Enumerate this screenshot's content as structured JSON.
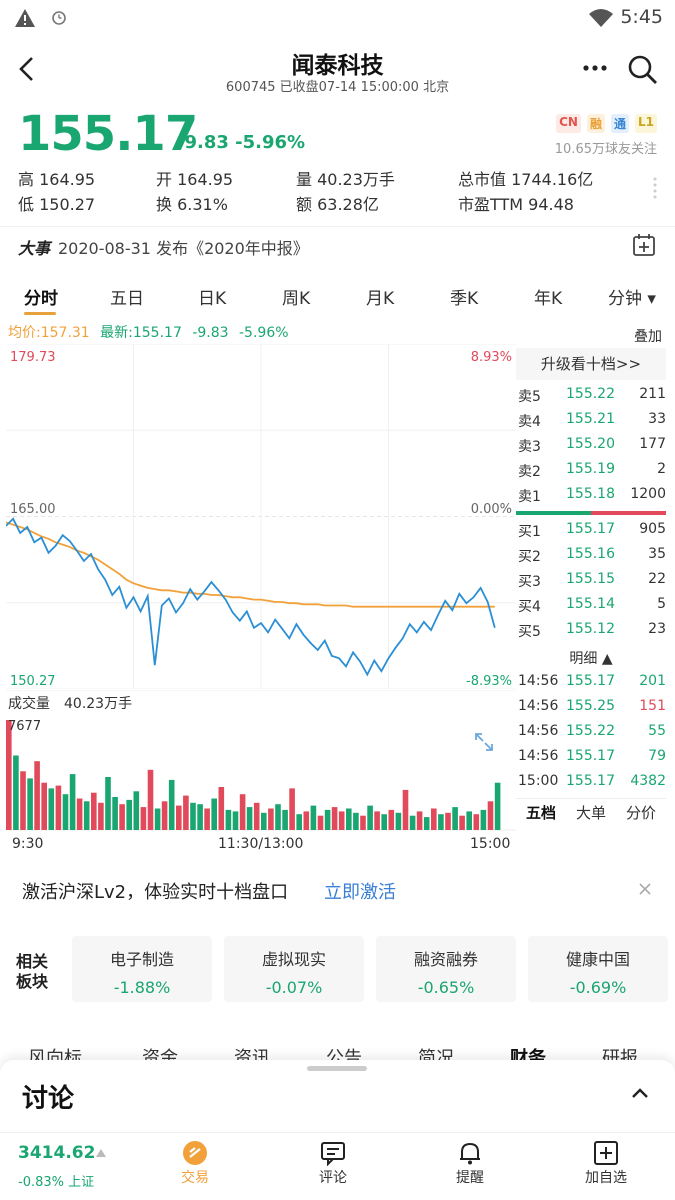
{
  "status_bar": {
    "time": "5:45"
  },
  "header": {
    "title": "闻泰科技",
    "subtitle": "600745 已收盘07-14 15:00:00 北京"
  },
  "quote": {
    "price": "155.17",
    "change": "-9.83",
    "change_pct": "-5.96%",
    "badges": [
      "CN",
      "融",
      "通",
      "L1"
    ],
    "followers": "10.65万球友关注",
    "high_label": "高",
    "high": "164.95",
    "open_label": "开",
    "open": "164.95",
    "volume_label": "量",
    "volume": "40.23万手",
    "mcap_label": "总市值",
    "mcap": "1744.16亿",
    "low_label": "低",
    "low": "150.27",
    "turnover_label": "换",
    "turnover": "6.31%",
    "amount_label": "额",
    "amount": "63.28亿",
    "pe_label": "市盈TTM",
    "pe": "94.48"
  },
  "event": {
    "label": "大事",
    "text": "2020-08-31 发布《2020年中报》"
  },
  "tabs": [
    "分时",
    "五日",
    "日K",
    "周K",
    "月K",
    "季K",
    "年K",
    "分钟 ▾"
  ],
  "chart_info": {
    "avg_label": "均价:157.31",
    "latest_label": "最新:155.17",
    "change": "-9.83",
    "change_pct": "-5.96%",
    "overlay": "叠加"
  },
  "chart_data": {
    "type": "line",
    "title": "",
    "y_top_label": "179.73",
    "y_mid_label": "165.00",
    "y_bottom_label": "150.27",
    "pct_top": "8.93%",
    "pct_mid": "0.00%",
    "pct_bottom": "-8.93%",
    "ylim": [
      150.27,
      179.73
    ],
    "x_ticks": [
      "9:30",
      "11:30/13:00",
      "15:00"
    ],
    "series": [
      {
        "name": "最新",
        "values": [
          164.2,
          164.8,
          163.6,
          164.1,
          162.8,
          163.2,
          161.9,
          162.5,
          163.4,
          162.9,
          162.1,
          161.2,
          161.8,
          160.5,
          159.6,
          158.3,
          159.0,
          157.2,
          158.1,
          156.9,
          158.2,
          152.3,
          157.4,
          158.0,
          156.8,
          157.6,
          158.8,
          157.9,
          158.6,
          159.4,
          158.7,
          157.9,
          156.8,
          156.1,
          156.9,
          155.5,
          155.9,
          155.1,
          156.2,
          155.4,
          154.6,
          155.8,
          154.9,
          154.2,
          153.6,
          154.4,
          153.1,
          152.9,
          152.2,
          153.4,
          152.6,
          151.5,
          152.7,
          151.8,
          152.9,
          153.8,
          154.6,
          155.8,
          155.1,
          156.0,
          155.3,
          156.6,
          157.8,
          157.0,
          158.4,
          157.6,
          158.1,
          158.9,
          157.7,
          155.5
        ]
      },
      {
        "name": "均价",
        "values": [
          164.5,
          164.3,
          164.1,
          163.9,
          163.6,
          163.3,
          163.1,
          162.8,
          162.6,
          162.4,
          162.1,
          161.9,
          161.6,
          161.3,
          160.9,
          160.5,
          160.1,
          159.6,
          159.3,
          159.1,
          158.9,
          158.8,
          158.7,
          158.7,
          158.6,
          158.5,
          158.5,
          158.4,
          158.4,
          158.3,
          158.3,
          158.2,
          158.1,
          158.1,
          158.0,
          157.9,
          157.9,
          157.8,
          157.7,
          157.7,
          157.6,
          157.6,
          157.5,
          157.5,
          157.5,
          157.4,
          157.4,
          157.4,
          157.4,
          157.3,
          157.3,
          157.3,
          157.3,
          157.3,
          157.3,
          157.3,
          157.3,
          157.3,
          157.3,
          157.3,
          157.3,
          157.3,
          157.3,
          157.3,
          157.3,
          157.3,
          157.3,
          157.3,
          157.3,
          157.3
        ]
      }
    ],
    "volume_label": "成交量",
    "volume_total": "40.23万手",
    "volume_max": "7677",
    "volume": [
      7677,
      5200,
      4100,
      3600,
      4800,
      3300,
      2900,
      3100,
      2500,
      3900,
      2200,
      2000,
      2600,
      1900,
      3700,
      2300,
      1800,
      2100,
      2700,
      1600,
      4200,
      1500,
      2000,
      3500,
      1700,
      2400,
      1900,
      1800,
      1500,
      2200,
      3000,
      1400,
      1300,
      2500,
      1600,
      1900,
      1200,
      1500,
      1800,
      1400,
      2900,
      1100,
      1300,
      1700,
      1000,
      1400,
      1600,
      1300,
      1500,
      1200,
      1000,
      1700,
      1300,
      1100,
      1400,
      1200,
      2800,
      1000,
      1300,
      900,
      1500,
      1100,
      1200,
      1600,
      1000,
      1300,
      1100,
      1400,
      2000,
      3300
    ],
    "volume_up": [
      true,
      false,
      true,
      false,
      true,
      true,
      false,
      true,
      false,
      false,
      true,
      false,
      true,
      true,
      false,
      false,
      true,
      false,
      false,
      true,
      true,
      false,
      true,
      false,
      true,
      true,
      false,
      false,
      true,
      false,
      true,
      false,
      false,
      true,
      false,
      true,
      false,
      true,
      false,
      false,
      true,
      false,
      true,
      false,
      true,
      false,
      true,
      true,
      false,
      false,
      true,
      false,
      true,
      false,
      true,
      false,
      true,
      false,
      true,
      false,
      true,
      false,
      true,
      false,
      true,
      false,
      true,
      false,
      true,
      false
    ]
  },
  "order_book": {
    "upgrade": "升级看十档>>",
    "asks": [
      {
        "label": "卖5",
        "price": "155.22",
        "vol": "211"
      },
      {
        "label": "卖4",
        "price": "155.21",
        "vol": "33"
      },
      {
        "label": "卖3",
        "price": "155.20",
        "vol": "177"
      },
      {
        "label": "卖2",
        "price": "155.19",
        "vol": "2"
      },
      {
        "label": "卖1",
        "price": "155.18",
        "vol": "1200"
      }
    ],
    "bids": [
      {
        "label": "买1",
        "price": "155.17",
        "vol": "905"
      },
      {
        "label": "买2",
        "price": "155.16",
        "vol": "35"
      },
      {
        "label": "买3",
        "price": "155.15",
        "vol": "22"
      },
      {
        "label": "买4",
        "price": "155.14",
        "vol": "5"
      },
      {
        "label": "买5",
        "price": "155.12",
        "vol": "23"
      }
    ],
    "detail_label": "明细 ▲",
    "ticks": [
      {
        "time": "14:56",
        "price": "155.17",
        "vol": "201",
        "color": "#1aa671"
      },
      {
        "time": "14:56",
        "price": "155.25",
        "vol": "151",
        "color": "#e14a5a"
      },
      {
        "time": "14:56",
        "price": "155.22",
        "vol": "55",
        "color": "#1aa671"
      },
      {
        "time": "14:56",
        "price": "155.17",
        "vol": "79",
        "color": "#1aa671"
      },
      {
        "time": "15:00",
        "price": "155.17",
        "vol": "4382",
        "color": "#1aa671"
      }
    ],
    "tabs": [
      "五档",
      "大单",
      "分价"
    ]
  },
  "promo": {
    "text": "激活沪深Lv2，体验实时十档盘口",
    "link": "立即激活"
  },
  "related": {
    "label": "相关板块",
    "items": [
      {
        "name": "电子制造",
        "change": "-1.88%"
      },
      {
        "name": "虚拟现实",
        "change": "-0.07%"
      },
      {
        "name": "融资融券",
        "change": "-0.65%"
      },
      {
        "name": "健康中国",
        "change": "-0.69%"
      }
    ]
  },
  "subtabs": [
    "风向标",
    "资金",
    "资讯",
    "公告",
    "简况",
    "财务",
    "研报"
  ],
  "drawer": {
    "title": "讨论"
  },
  "bottom_nav": {
    "index_value": "3414.62",
    "index_change": "-0.83% 上证",
    "items": [
      {
        "label": "交易",
        "icon": "trade-icon"
      },
      {
        "label": "评论",
        "icon": "comment-icon"
      },
      {
        "label": "提醒",
        "icon": "bell-icon"
      },
      {
        "label": "加自选",
        "icon": "add-watchlist-icon"
      }
    ]
  },
  "colors": {
    "up": "#e14a5a",
    "down": "#1aa671",
    "avg": "#f2a13a",
    "price_line": "#2a8fd4",
    "accent": "#e9a23b"
  }
}
